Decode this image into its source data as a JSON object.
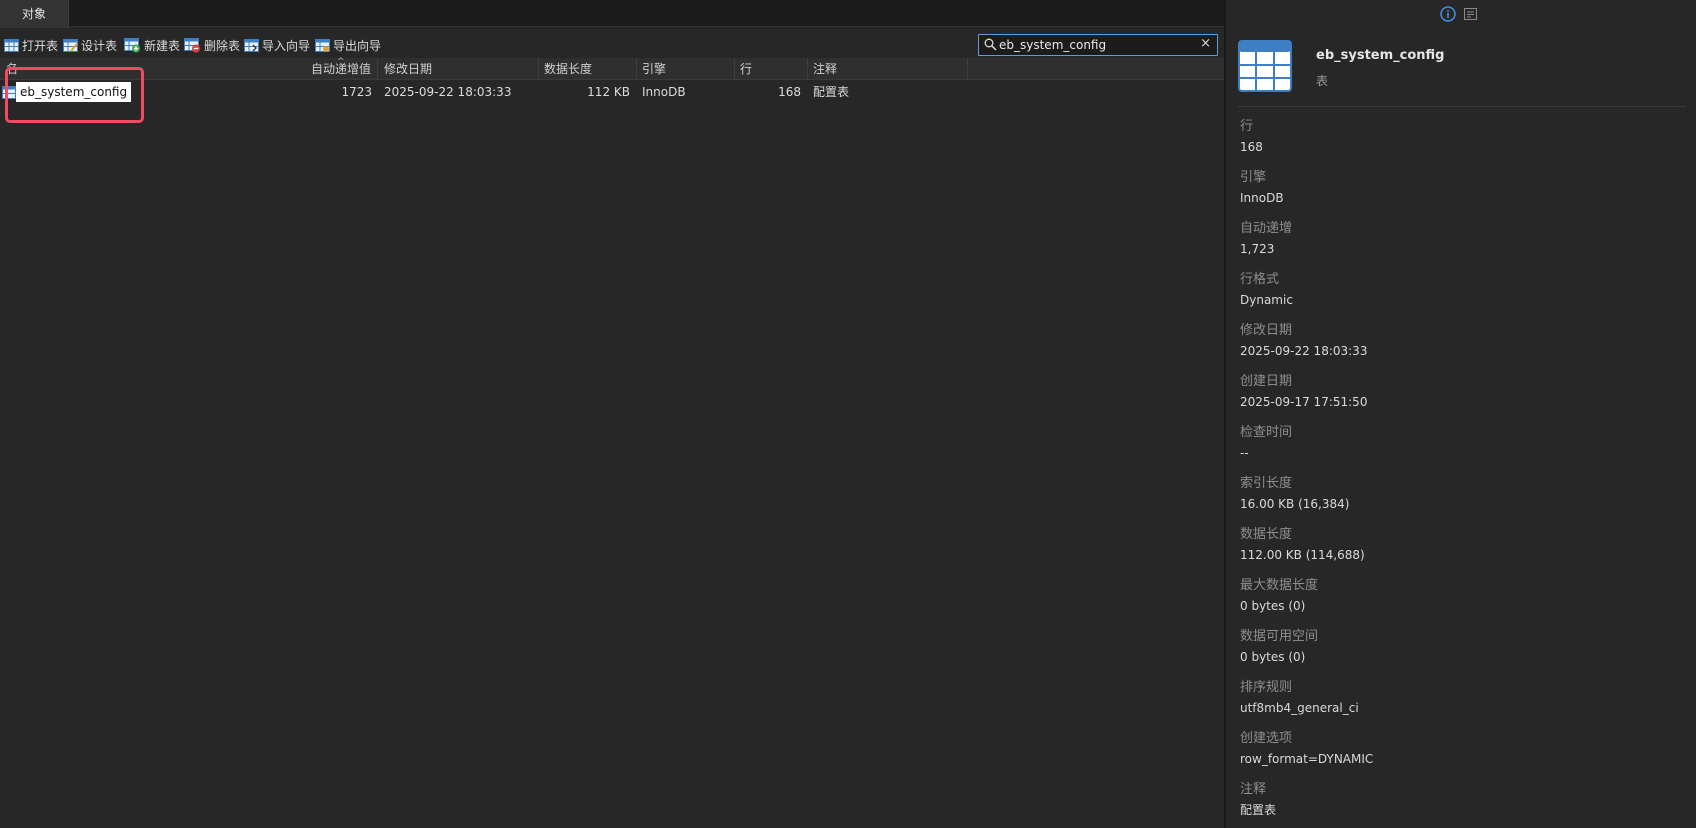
{
  "tabs": {
    "objects": "对象"
  },
  "toolbar": {
    "open_table": "打开表",
    "design_table": "设计表",
    "new_table": "新建表",
    "delete_table": "删除表",
    "import_wizard": "导入向导",
    "export_wizard": "导出向导"
  },
  "search": {
    "value": "eb_system_config",
    "clear": "×"
  },
  "columns": {
    "name": "名",
    "auto_increment": "自动递增值",
    "modified": "修改日期",
    "data_length": "数据长度",
    "engine": "引擎",
    "rows": "行",
    "comment": "注释"
  },
  "rows": [
    {
      "name": "eb_system_config",
      "auto_increment": "1723",
      "modified": "2025-09-22 18:03:33",
      "data_length": "112 KB",
      "engine": "InnoDB",
      "rows": "168",
      "comment": "配置表"
    }
  ],
  "info": {
    "title": "eb_system_config",
    "subtitle": "表",
    "properties": [
      {
        "label": "行",
        "value": "168"
      },
      {
        "label": "引擎",
        "value": "InnoDB"
      },
      {
        "label": "自动递增",
        "value": "1,723"
      },
      {
        "label": "行格式",
        "value": "Dynamic"
      },
      {
        "label": "修改日期",
        "value": "2025-09-22 18:03:33"
      },
      {
        "label": "创建日期",
        "value": "2025-09-17 17:51:50"
      },
      {
        "label": "检查时间",
        "value": "--"
      },
      {
        "label": "索引长度",
        "value": "16.00 KB (16,384)"
      },
      {
        "label": "数据长度",
        "value": "112.00 KB (114,688)"
      },
      {
        "label": "最大数据长度",
        "value": "0 bytes (0)"
      },
      {
        "label": "数据可用空间",
        "value": "0 bytes (0)"
      },
      {
        "label": "排序规则",
        "value": "utf8mb4_general_ci"
      },
      {
        "label": "创建选项",
        "value": "row_format=DYNAMIC"
      },
      {
        "label": "注释",
        "value": "配置表"
      }
    ]
  },
  "colors": {
    "accent": "#5e9ed6",
    "highlight": "#ef4b63",
    "background": "#272727",
    "table_icon": "#3d7fc2"
  },
  "icons": {
    "info": "info-icon",
    "ddl": "ddl-icon",
    "table": "table-icon",
    "search": "search-icon"
  }
}
